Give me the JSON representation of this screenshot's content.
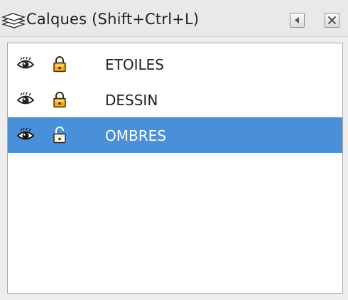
{
  "panel": {
    "title": "Calques (Shift+Ctrl+L)",
    "title_icon": "layers-icon",
    "collapse_icon": "collapse-left-icon",
    "close_icon": "close-icon"
  },
  "layers": [
    {
      "name": "ETOILES",
      "visible": true,
      "locked": true,
      "selected": false,
      "visibility_icon": "eye-icon",
      "lock_icon": "lock-closed-icon"
    },
    {
      "name": "DESSIN",
      "visible": true,
      "locked": true,
      "selected": false,
      "visibility_icon": "eye-icon",
      "lock_icon": "lock-closed-icon"
    },
    {
      "name": "OMBRES",
      "visible": true,
      "locked": false,
      "selected": true,
      "visibility_icon": "eye-icon",
      "lock_icon": "lock-open-icon"
    }
  ],
  "colors": {
    "selection": "#4a90d9",
    "lock_fill": "#f4a81d",
    "list_background": "#ffffff",
    "panel_background": "#ededed"
  }
}
